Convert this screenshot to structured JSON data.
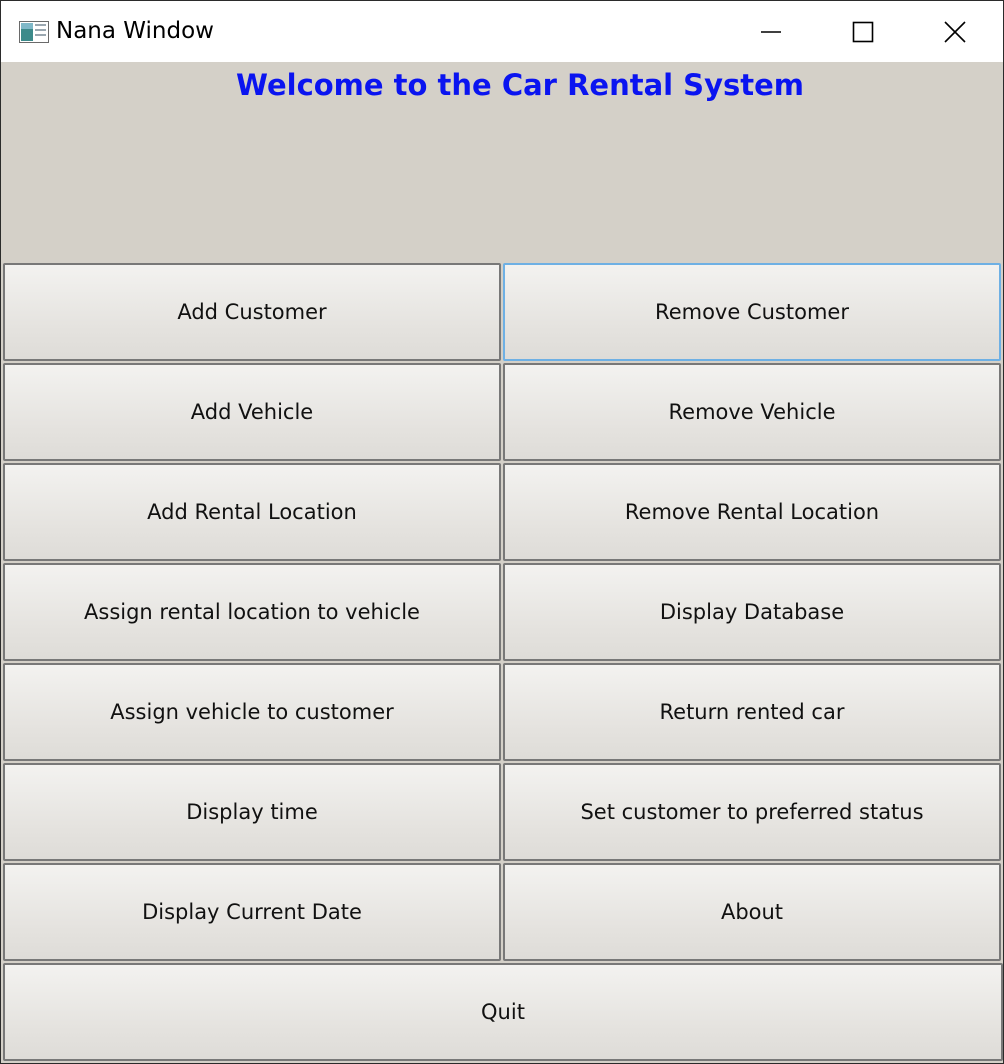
{
  "window": {
    "title": "Nana Window",
    "controls": {
      "minimize_icon": "minimize-icon",
      "maximize_icon": "maximize-icon",
      "close_icon": "close-icon"
    }
  },
  "header": {
    "welcome": "Welcome to the Car Rental System",
    "welcome_color": "#0a14f0"
  },
  "buttons": {
    "add_customer": "Add Customer",
    "remove_customer": "Remove Customer",
    "add_vehicle": "Add Vehicle",
    "remove_vehicle": "Remove Vehicle",
    "add_rental_location": "Add Rental Location",
    "remove_rental_location": "Remove Rental Location",
    "assign_location_to_vehicle": "Assign rental location to vehicle",
    "display_database": "Display Database",
    "assign_vehicle_to_customer": "Assign vehicle to customer",
    "return_rented_car": "Return rented car",
    "display_time": "Display time",
    "set_preferred_status": "Set customer to preferred status",
    "display_current_date": "Display Current Date",
    "about": "About",
    "quit": "Quit"
  },
  "focus_color": "#6eb0e4"
}
